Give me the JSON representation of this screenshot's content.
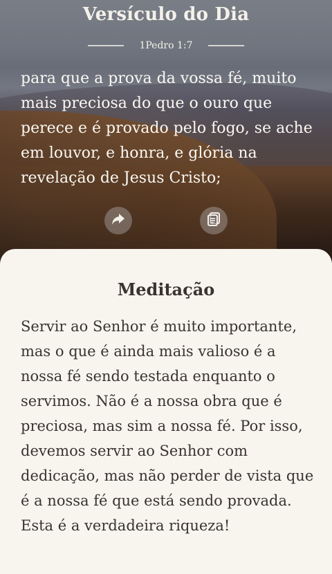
{
  "header": {
    "title": "Versículo do Dia",
    "reference": "1Pedro 1:7"
  },
  "verse": {
    "text": "para que a prova da vossa fé, muito mais preciosa do que o ouro que perece e é provado pelo fogo, se ache em louvor, e honra, e glória na revelação de Jesus Cristo;"
  },
  "actions": {
    "share_icon": "share-arrow-icon",
    "copy_icon": "copy-icon"
  },
  "meditation": {
    "title": "Meditação",
    "text": "Servir ao Senhor é muito importante, mas o que é ainda mais valioso é a nossa fé sendo testada enquanto o servimos. Não é a nossa obra que é preciosa, mas sim a nossa fé. Por isso, devemos servir ao Senhor com dedicação, mas não perder de vista que é a nossa fé que está sendo provada. Esta é a verdadeira riqueza!"
  },
  "colors": {
    "panel_background": "#f7f5ee",
    "text_dark": "#3a3330",
    "text_light": "#fbf8f2"
  }
}
